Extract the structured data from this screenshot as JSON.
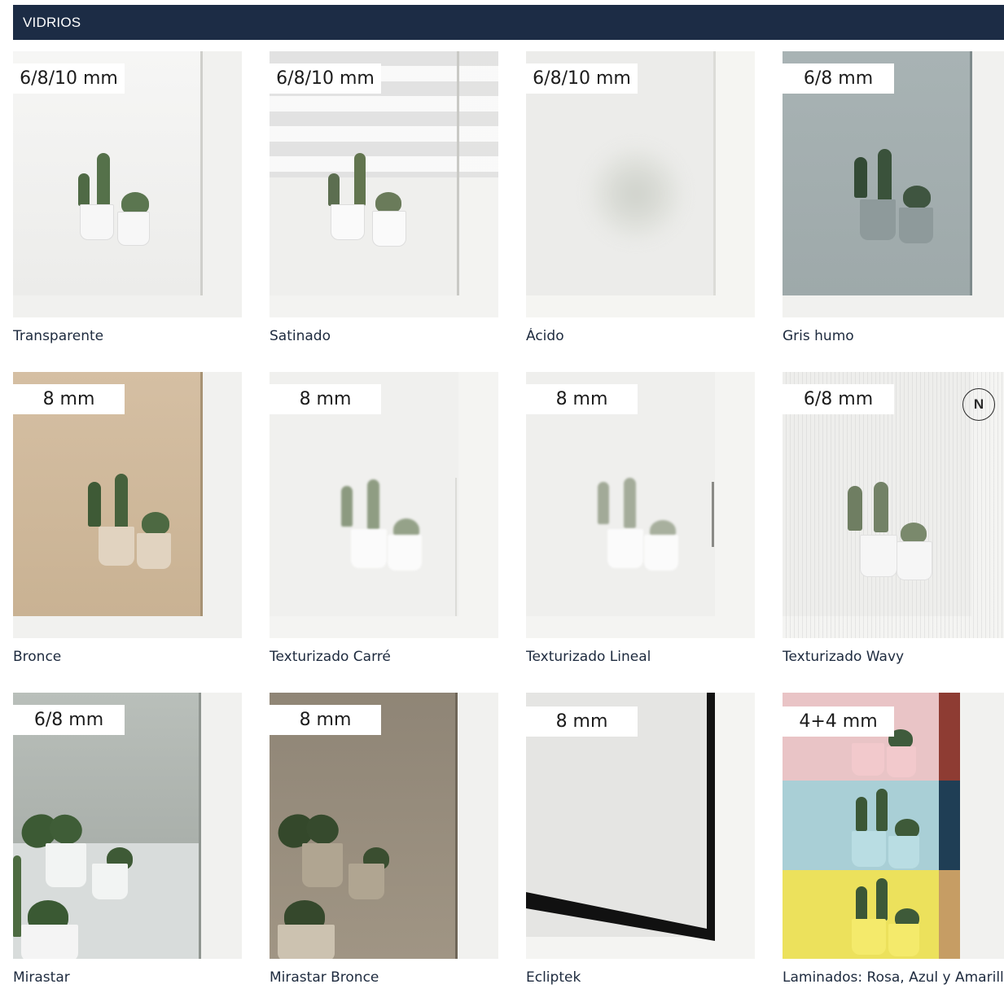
{
  "section": {
    "title": "VIDRIOS"
  },
  "colors": {
    "header_bg": "#1c2c45",
    "header_text": "#ffffff"
  },
  "items": [
    {
      "label": "Transparente",
      "thickness": "6/8/10 mm",
      "tint": "clear"
    },
    {
      "label": "Satinado",
      "thickness": "6/8/10 mm",
      "tint": "striped"
    },
    {
      "label": "Ácido",
      "thickness": "6/8/10 mm",
      "tint": "frosted"
    },
    {
      "label": "Gris humo",
      "thickness": "6/8 mm",
      "tint": "grey"
    },
    {
      "label": "Bronce",
      "thickness": "8 mm",
      "tint": "bronze"
    },
    {
      "label": "Texturizado Carré",
      "thickness": "8 mm",
      "tint": "textured"
    },
    {
      "label": "Texturizado Lineal",
      "thickness": "8 mm",
      "tint": "textured"
    },
    {
      "label": "Texturizado Wavy",
      "thickness": "6/8 mm",
      "tint": "ribbed",
      "badge": "N"
    },
    {
      "label": "Mirastar",
      "thickness": "6/8 mm",
      "tint": "mirror"
    },
    {
      "label": "Mirastar Bronce",
      "thickness": "8 mm",
      "tint": "mirror-bronze"
    },
    {
      "label": "Ecliptek",
      "thickness": "8 mm",
      "tint": "black-frame"
    },
    {
      "label": "Laminados: Rosa, Azul y Amarillo",
      "thickness": "4+4 mm",
      "tint": "laminated"
    }
  ]
}
